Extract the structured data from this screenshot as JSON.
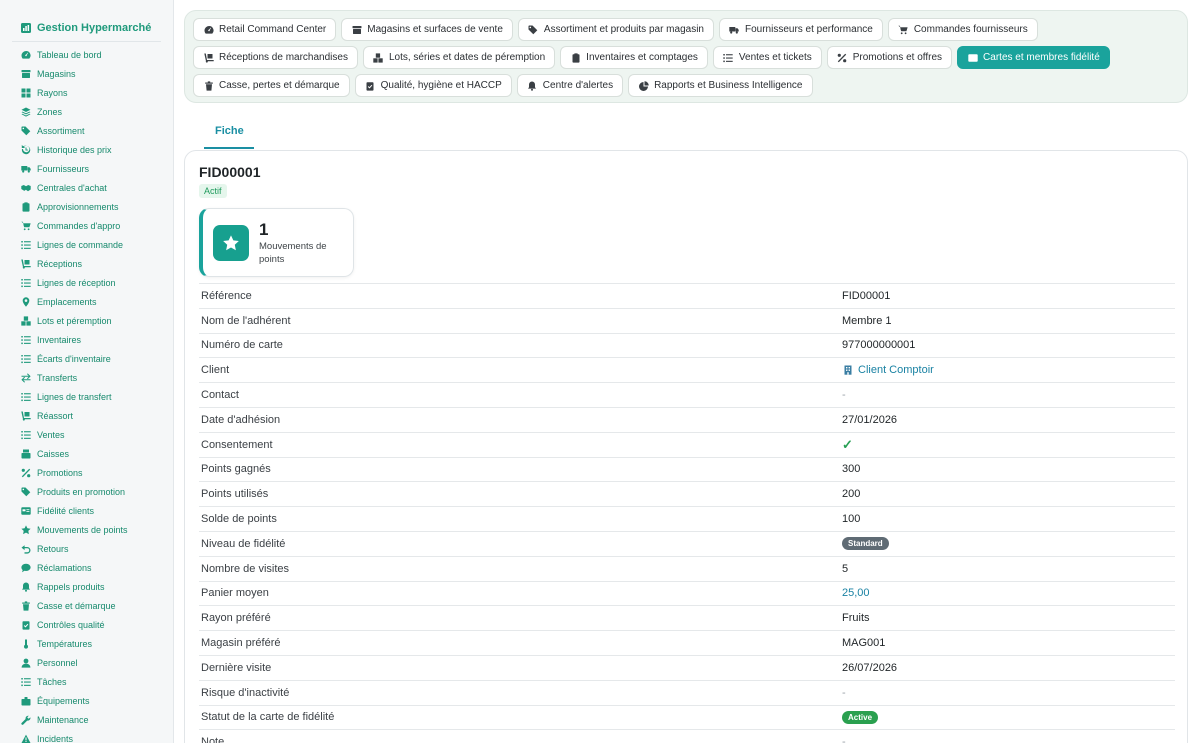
{
  "app": {
    "title": "Gestion Hypermarché",
    "logo_icon": "chart-icon"
  },
  "sidebar": {
    "items": [
      {
        "label": "Tableau de bord",
        "icon": "gauge-icon"
      },
      {
        "label": "Magasins",
        "icon": "store-icon"
      },
      {
        "label": "Rayons",
        "icon": "grid-icon"
      },
      {
        "label": "Zones",
        "icon": "layers-icon"
      },
      {
        "label": "Assortiment",
        "icon": "tags-icon"
      },
      {
        "label": "Historique des prix",
        "icon": "history-icon"
      },
      {
        "label": "Fournisseurs",
        "icon": "truck-icon"
      },
      {
        "label": "Centrales d'achat",
        "icon": "handshake-icon"
      },
      {
        "label": "Approvisionnements",
        "icon": "clipboard-icon"
      },
      {
        "label": "Commandes d'appro",
        "icon": "cart-icon"
      },
      {
        "label": "Lignes de commande",
        "icon": "list-icon"
      },
      {
        "label": "Réceptions",
        "icon": "dolly-icon"
      },
      {
        "label": "Lignes de réception",
        "icon": "list-icon"
      },
      {
        "label": "Emplacements",
        "icon": "pin-icon"
      },
      {
        "label": "Lots et péremption",
        "icon": "boxes-icon"
      },
      {
        "label": "Inventaires",
        "icon": "list-icon"
      },
      {
        "label": "Écarts d'inventaire",
        "icon": "list-icon"
      },
      {
        "label": "Transferts",
        "icon": "arrows-icon"
      },
      {
        "label": "Lignes de transfert",
        "icon": "list-icon"
      },
      {
        "label": "Réassort",
        "icon": "dolly-icon"
      },
      {
        "label": "Ventes",
        "icon": "list-icon"
      },
      {
        "label": "Caisses",
        "icon": "register-icon"
      },
      {
        "label": "Promotions",
        "icon": "percent-icon"
      },
      {
        "label": "Produits en promotion",
        "icon": "tags-icon"
      },
      {
        "label": "Fidélité clients",
        "icon": "card-icon"
      },
      {
        "label": "Mouvements de points",
        "icon": "star-icon"
      },
      {
        "label": "Retours",
        "icon": "undo-icon"
      },
      {
        "label": "Réclamations",
        "icon": "comment-icon"
      },
      {
        "label": "Rappels produits",
        "icon": "bell-icon"
      },
      {
        "label": "Casse et démarque",
        "icon": "trash-icon"
      },
      {
        "label": "Contrôles qualité",
        "icon": "clipboard-check-icon"
      },
      {
        "label": "Températures",
        "icon": "thermometer-icon"
      },
      {
        "label": "Personnel",
        "icon": "user-icon"
      },
      {
        "label": "Tâches",
        "icon": "list-icon"
      },
      {
        "label": "Équipements",
        "icon": "tools-icon"
      },
      {
        "label": "Maintenance",
        "icon": "wrench-icon"
      },
      {
        "label": "Incidents",
        "icon": "warning-icon"
      }
    ]
  },
  "tabs": [
    {
      "label": "Retail Command Center",
      "icon": "gauge-icon"
    },
    {
      "label": "Magasins et surfaces de vente",
      "icon": "store-icon"
    },
    {
      "label": "Assortiment et produits par magasin",
      "icon": "tags-icon"
    },
    {
      "label": "Fournisseurs et performance",
      "icon": "truck-icon"
    },
    {
      "label": "Commandes fournisseurs",
      "icon": "cart-icon"
    },
    {
      "label": "Réceptions de marchandises",
      "icon": "dolly-icon"
    },
    {
      "label": "Lots, séries et dates de péremption",
      "icon": "boxes-icon"
    },
    {
      "label": "Inventaires et comptages",
      "icon": "clipboard-icon"
    },
    {
      "label": "Ventes et tickets",
      "icon": "list-icon"
    },
    {
      "label": "Promotions et offres",
      "icon": "percent-icon"
    },
    {
      "label": "Cartes et membres fidélité",
      "icon": "card-icon",
      "active": true
    },
    {
      "label": "Casse, pertes et démarque",
      "icon": "trash-icon"
    },
    {
      "label": "Qualité, hygiène et HACCP",
      "icon": "clipboard-check-icon"
    },
    {
      "label": "Centre d'alertes",
      "icon": "bell-icon"
    },
    {
      "label": "Rapports et Business Intelligence",
      "icon": "piechart-icon"
    }
  ],
  "subtab": {
    "label": "Fiche"
  },
  "record": {
    "title": "FID00001",
    "status": "Actif",
    "stat": {
      "value": "1",
      "label": "Mouvements de points",
      "icon": "star-icon"
    },
    "colors": {
      "accent": "#1aa39c",
      "link": "#1a82a3",
      "green": "#2aa04f"
    },
    "fields": [
      {
        "label": "Référence",
        "value": "FID00001",
        "kind": "text"
      },
      {
        "label": "Nom de l'adhérent",
        "value": "Membre 1",
        "kind": "text"
      },
      {
        "label": "Numéro de carte",
        "value": "977000000001",
        "kind": "text"
      },
      {
        "label": "Client",
        "value": "Client Comptoir",
        "kind": "link",
        "icon": "building-icon"
      },
      {
        "label": "Contact",
        "value": "-",
        "kind": "dash"
      },
      {
        "label": "Date d'adhésion",
        "value": "27/01/2026",
        "kind": "text"
      },
      {
        "label": "Consentement",
        "value": "✓",
        "kind": "check"
      },
      {
        "label": "Points gagnés",
        "value": "300",
        "kind": "text"
      },
      {
        "label": "Points utilisés",
        "value": "200",
        "kind": "text"
      },
      {
        "label": "Solde de points",
        "value": "100",
        "kind": "text"
      },
      {
        "label": "Niveau de fidélité",
        "value": "Standard",
        "kind": "pill-grey"
      },
      {
        "label": "Nombre de visites",
        "value": "5",
        "kind": "text"
      },
      {
        "label": "Panier moyen",
        "value": "25,00",
        "kind": "teal"
      },
      {
        "label": "Rayon préféré",
        "value": "Fruits",
        "kind": "text"
      },
      {
        "label": "Magasin préféré",
        "value": "MAG001",
        "kind": "text"
      },
      {
        "label": "Dernière visite",
        "value": "26/07/2026",
        "kind": "text"
      },
      {
        "label": "Risque d'inactivité",
        "value": "-",
        "kind": "dash"
      },
      {
        "label": "Statut de la carte de fidélité",
        "value": "Active",
        "kind": "pill-green"
      },
      {
        "label": "Note",
        "value": "-",
        "kind": "dash"
      }
    ]
  }
}
